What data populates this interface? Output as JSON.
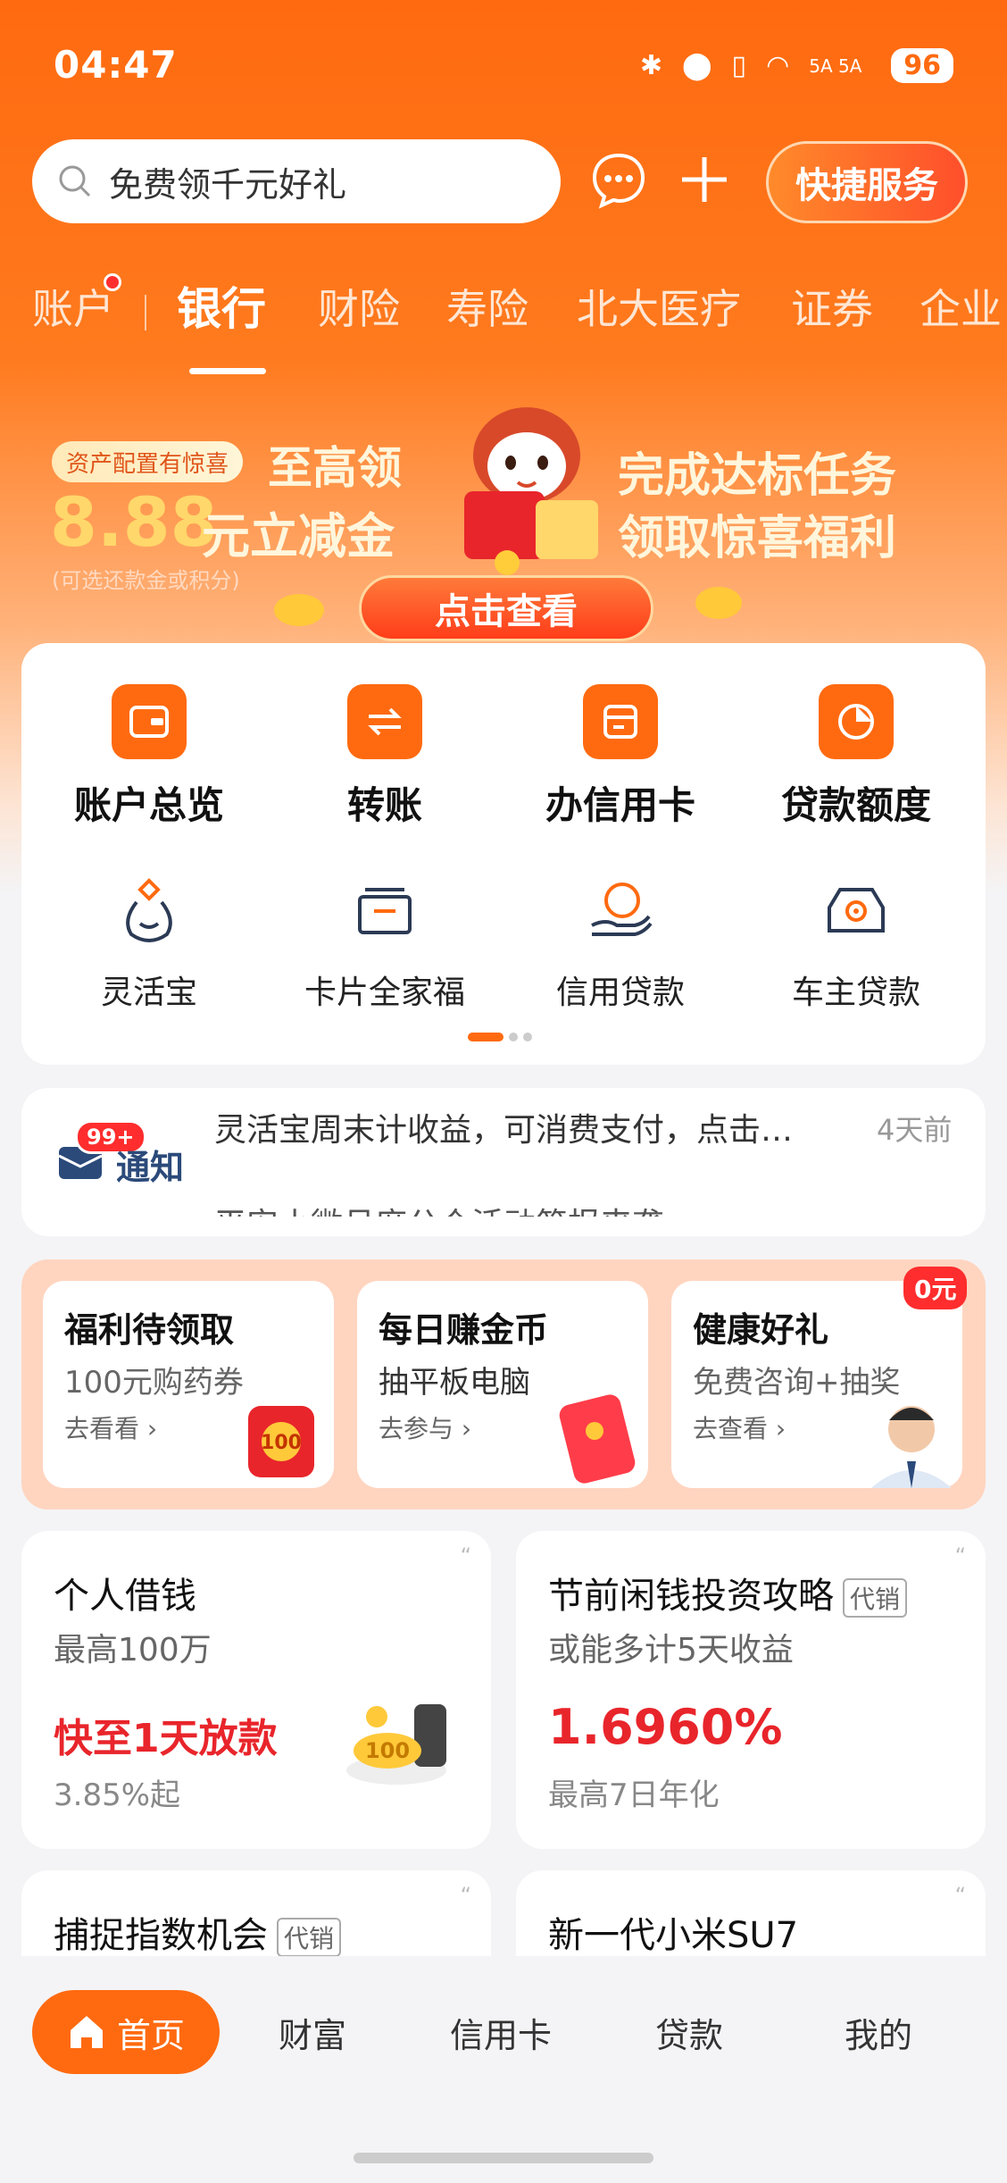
{
  "status": {
    "time": "04:47",
    "battery": "96",
    "signal": "5A 5A"
  },
  "header": {
    "search_placeholder": "免费领千元好礼",
    "quick_service": "快捷服务"
  },
  "tabs": [
    {
      "label": "账户"
    },
    {
      "label": "银行"
    },
    {
      "label": "财险"
    },
    {
      "label": "寿险"
    },
    {
      "label": "北大医疗"
    },
    {
      "label": "证券"
    },
    {
      "label": "企业"
    }
  ],
  "banner": {
    "tag": "资产配置有惊喜",
    "line1": "至高领",
    "amount": "8.88",
    "amount_suffix": "元立减金",
    "note": "(可选还款金或积分)",
    "right1": "完成达标任务",
    "right2": "领取惊喜福利",
    "button": "点击查看"
  },
  "grid": {
    "primary": [
      {
        "label": "账户总览",
        "icon": "wallet-icon"
      },
      {
        "label": "转账",
        "icon": "transfer-icon"
      },
      {
        "label": "办信用卡",
        "icon": "credit-card-icon"
      },
      {
        "label": "贷款额度",
        "icon": "pie-chart-icon"
      }
    ],
    "secondary": [
      {
        "label": "灵活宝",
        "icon": "money-bag-icon"
      },
      {
        "label": "卡片全家福",
        "icon": "card-stack-icon"
      },
      {
        "label": "信用贷款",
        "icon": "loan-hand-icon"
      },
      {
        "label": "车主贷款",
        "icon": "car-icon"
      }
    ]
  },
  "notice": {
    "badge": "99+",
    "title": "通知",
    "text": "灵活宝周末计收益，可消费支付，点击…",
    "time": "4天前",
    "text2": "平安小微月度公众活动简报来袭"
  },
  "promo": [
    {
      "title": "福利待领取",
      "sub": "100元购药券",
      "link": "去看看"
    },
    {
      "title": "每日赚金币",
      "sub": "抽平板电脑",
      "link": "去参与"
    },
    {
      "title": "健康好礼",
      "sub": "免费咨询+抽奖",
      "link": "去查看",
      "badge": "0元"
    }
  ],
  "feature_cards": [
    {
      "title": "个人借钱",
      "sub": "最高100万",
      "highlight": "快至1天放款",
      "footer": "3.85%起"
    },
    {
      "title": "节前闲钱投资攻略",
      "tag": "代销",
      "sub": "或能多计5天收益",
      "highlight": "1.6960%",
      "footer": "最高7日年化"
    }
  ],
  "more_cards": [
    {
      "title": "捕捉指数机会",
      "tag": "代销"
    },
    {
      "title": "新一代小米SU7"
    }
  ],
  "bottom_nav": [
    {
      "label": "首页",
      "icon": "home-icon"
    },
    {
      "label": "财富"
    },
    {
      "label": "信用卡"
    },
    {
      "label": "贷款"
    },
    {
      "label": "我的"
    }
  ],
  "colors": {
    "brand": "#ff6a10",
    "red": "#e8252b"
  }
}
